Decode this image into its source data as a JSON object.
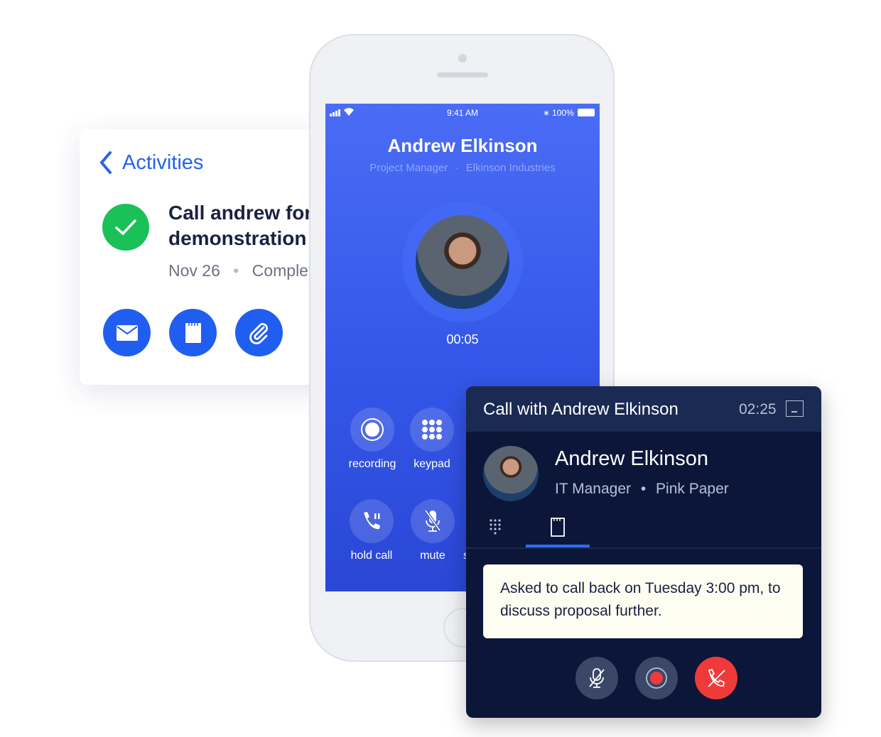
{
  "activity_card": {
    "back_label": "Activities",
    "task_title_line1": "Call andrew for a",
    "task_title_line2": "demonstration",
    "date": "Nov 26",
    "status": "Completed",
    "actions": [
      {
        "icon": "mail-icon"
      },
      {
        "icon": "note-icon"
      },
      {
        "icon": "paperclip-icon"
      }
    ],
    "colors": {
      "accent": "#1f5ef0",
      "success": "#19c156"
    }
  },
  "phone": {
    "status_bar": {
      "time": "9:41 AM",
      "battery": "100%"
    },
    "contact_name": "Andrew Elkinson",
    "contact_title": "Project Manager",
    "contact_company": "Elkinson Industries",
    "call_timer": "00:05",
    "controls": [
      {
        "label": "recording",
        "icon": "record-icon"
      },
      {
        "label": "keypad",
        "icon": "keypad-icon"
      },
      {
        "label": "hold call",
        "icon": "hold-call-icon"
      },
      {
        "label": "mute",
        "icon": "mute-icon"
      },
      {
        "label": "speaker",
        "icon": "speaker-icon"
      }
    ]
  },
  "call_panel": {
    "title": "Call with Andrew Elkinson",
    "duration": "02:25",
    "contact_name": "Andrew Elkinson",
    "contact_title": "IT Manager",
    "contact_company": "Pink Paper",
    "tabs": [
      {
        "icon": "keypad-icon"
      },
      {
        "icon": "note-icon",
        "active": true
      }
    ],
    "note_text": "Asked to call back on Tuesday 3:00 pm, to discuss proposal further.",
    "colors": {
      "header": "#1b2a52",
      "body": "#0b1638",
      "hangup": "#f03a3a",
      "tab_active": "#2f6bf0"
    }
  }
}
